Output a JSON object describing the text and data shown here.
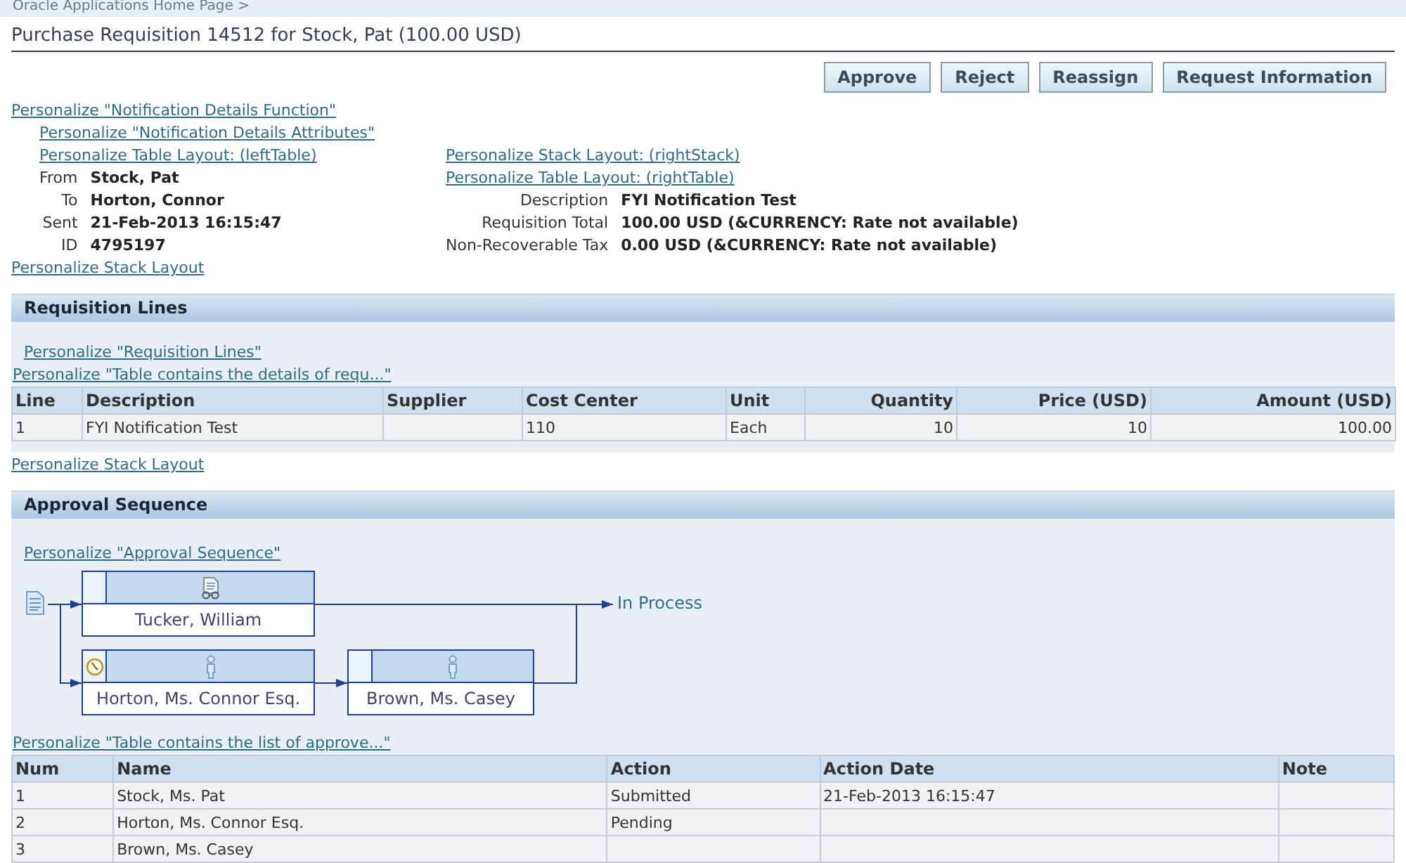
{
  "breadcrumb": "Oracle Applications Home Page >",
  "title": "Purchase Requisition 14512 for Stock, Pat (100.00 USD)",
  "actions": [
    "Approve",
    "Reject",
    "Reassign",
    "Request Information"
  ],
  "function_link": "Personalize \"Notification Details Function\"",
  "attributes_link": "Personalize \"Notification Details Attributes\"",
  "left": {
    "link": "Personalize Table Layout: (leftTable)",
    "fields": [
      {
        "label": "From",
        "value": "Stock, Pat"
      },
      {
        "label": "To",
        "value": "Horton, Connor"
      },
      {
        "label": "Sent",
        "value": "21-Feb-2013 16:15:47"
      },
      {
        "label": "ID",
        "value": "4795197"
      }
    ]
  },
  "right": {
    "links": [
      "Personalize Stack Layout: (rightStack)",
      "Personalize Table Layout: (rightTable)"
    ],
    "fields": [
      {
        "label": "Description",
        "value": "FYI Notification Test"
      },
      {
        "label": "Requisition Total",
        "value": "100.00 USD (&CURRENCY: Rate not available)"
      },
      {
        "label": "Non-Recoverable Tax",
        "value": "0.00 USD (&CURRENCY: Rate not available)"
      }
    ]
  },
  "stack_link": "Personalize Stack Layout",
  "requisition_lines": {
    "title": "Requisition Lines",
    "link": "Personalize \"Requisition Lines\"",
    "table_link": "Personalize \"Table contains the details of requ...\"",
    "columns": [
      "Line",
      "Description",
      "Supplier",
      "Cost Center",
      "Unit",
      "Quantity",
      "Price (USD)",
      "Amount (USD)"
    ],
    "rows": [
      [
        "1",
        "FYI Notification Test",
        "",
        "110",
        "Each",
        "10",
        "10",
        "100.00"
      ]
    ]
  },
  "lines_stack_link": "Personalize Stack Layout",
  "approval": {
    "title": "Approval Sequence",
    "link": "Personalize \"Approval Sequence\"",
    "branches": [
      [
        {
          "name": "Tucker, William",
          "kind": "fyi",
          "pending": false
        }
      ],
      [
        {
          "name": "Horton, Ms. Connor Esq.",
          "kind": "approver",
          "pending": true
        },
        {
          "name": "Brown, Ms. Casey",
          "kind": "approver",
          "pending": false
        }
      ]
    ],
    "end_label": "In Process",
    "table_link": "Personalize \"Table contains the list of approve...\"",
    "columns": [
      "Num",
      "Name",
      "Action",
      "Action Date",
      "Note"
    ],
    "rows": [
      [
        "1",
        "Stock, Ms. Pat",
        "Submitted",
        "21-Feb-2013 16:15:47",
        ""
      ],
      [
        "2",
        "Horton, Ms. Connor Esq.",
        "Pending",
        "",
        ""
      ],
      [
        "3",
        "Brown, Ms. Casey",
        "",
        "",
        ""
      ]
    ]
  }
}
